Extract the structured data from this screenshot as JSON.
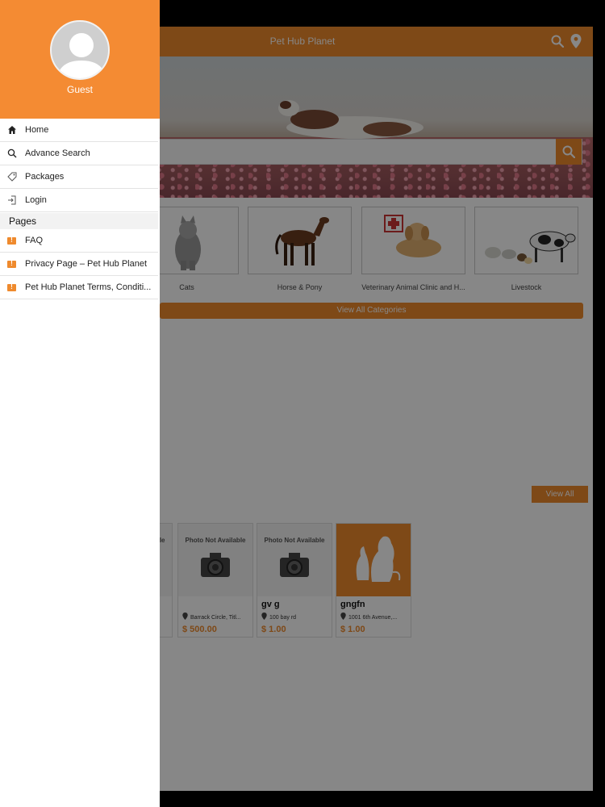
{
  "app": {
    "title": "Pet Hub Planet",
    "accent_color": "#ef8a2d",
    "header_icons": [
      "search-icon",
      "location-pin-icon"
    ]
  },
  "categories": [
    {
      "label": "Cats"
    },
    {
      "label": "Horse & Pony"
    },
    {
      "label": "Veterinary Animal Clinic and H..."
    },
    {
      "label": "Livestock"
    }
  ],
  "view_all_categories_label": "View All Categories",
  "view_all_label": "View All",
  "listings": [
    {
      "photo_text": "Photo Not Available",
      "title": "",
      "address": "Barrack Circle, Titl...",
      "price": "$ 500.00"
    },
    {
      "photo_text": "Photo Not Available",
      "title": "gv g",
      "address": "100 bay rd",
      "price": "$ 1.00"
    },
    {
      "photo_text": "",
      "title": "gngfn",
      "address": "1001 6th Avenue,...",
      "price": "$ 1.00"
    }
  ],
  "drawer": {
    "user_name": "Guest",
    "menu": [
      {
        "label": "Home",
        "icon": "home-icon"
      },
      {
        "label": "Advance Search",
        "icon": "search-icon"
      },
      {
        "label": "Packages",
        "icon": "tag-icon"
      },
      {
        "label": "Login",
        "icon": "login-icon"
      }
    ],
    "pages_header": "Pages",
    "pages": [
      {
        "label": "FAQ",
        "icon": "warning-icon"
      },
      {
        "label": "Privacy Page – Pet Hub Planet",
        "icon": "warning-icon"
      },
      {
        "label": "Pet Hub Planet Terms, Conditi...",
        "icon": "warning-icon"
      }
    ]
  }
}
